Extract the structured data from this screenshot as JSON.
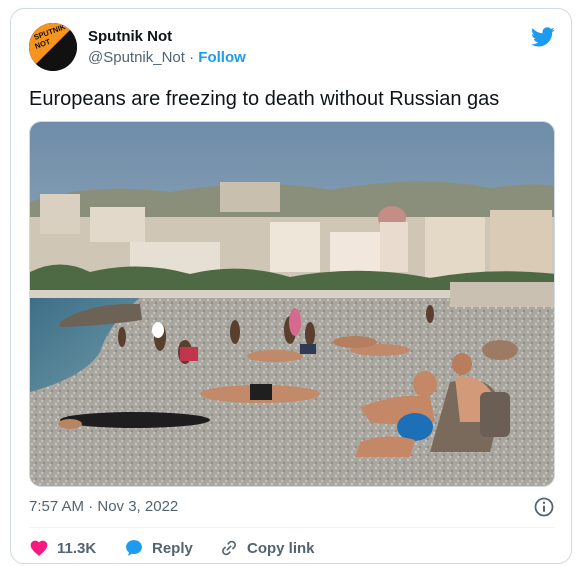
{
  "author": {
    "name": "Sputnik Not",
    "handle": "@Sputnik_Not",
    "separator": "·",
    "follow_label": "Follow",
    "avatar_text": [
      "SPUTNIK",
      "NOT"
    ]
  },
  "tweet": {
    "text": "Europeans are freezing to death without Russian gas",
    "timestamp": "7:57 AM · Nov 3, 2022"
  },
  "actions": {
    "like_count": "11.3K",
    "reply_label": "Reply",
    "copy_label": "Copy link"
  },
  "colors": {
    "accent": "#1d9bf0",
    "like": "#f91880",
    "avatar_orange": "#f7941d"
  },
  "icons": [
    "twitter-bird-icon",
    "info-icon",
    "heart-icon",
    "reply-bubble-icon",
    "link-icon"
  ]
}
